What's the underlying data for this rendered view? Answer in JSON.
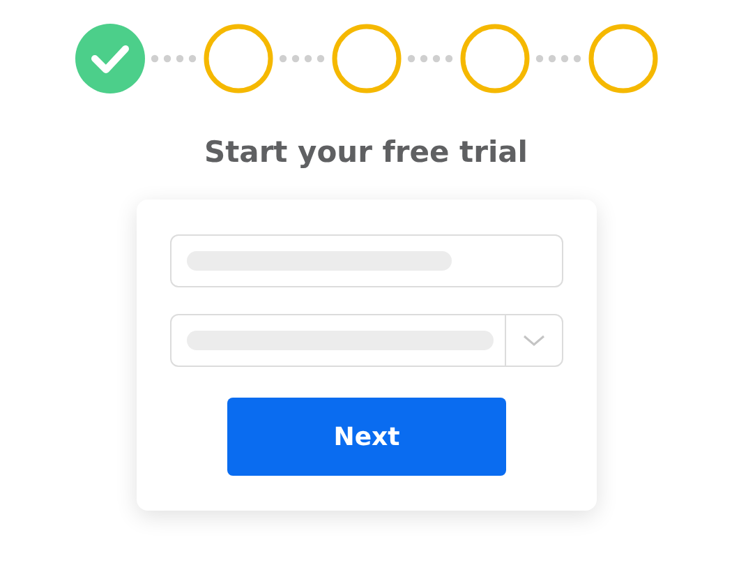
{
  "steps": [
    {
      "completed": true
    },
    {
      "completed": false
    },
    {
      "completed": false
    },
    {
      "completed": false
    },
    {
      "completed": false
    }
  ],
  "title": "Start your free trial",
  "form": {
    "fields": [
      {
        "kind": "text"
      },
      {
        "kind": "select"
      }
    ],
    "button": "Next"
  }
}
